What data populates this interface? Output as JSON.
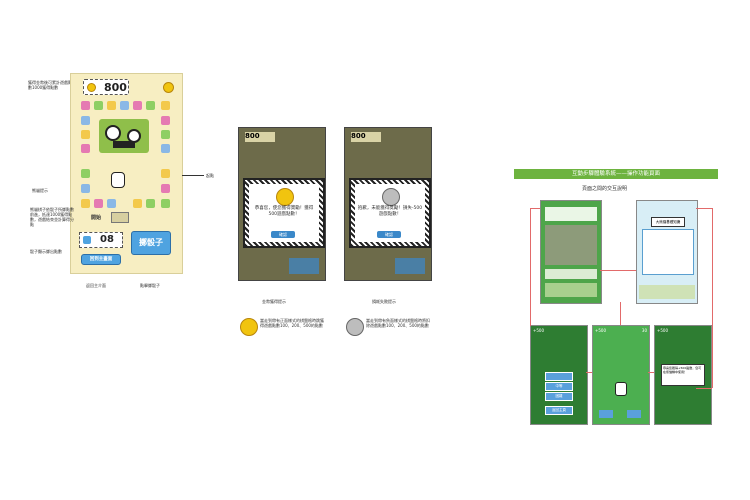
{
  "board": {
    "score": "800",
    "score_note": "獲得金幣後可累計遊戲點數1000獲得點數",
    "label_start": "開始",
    "label_right": "起點",
    "dice_value": "08",
    "throw_label": "擲骰子",
    "back_label": "回到主畫面",
    "note_monkey": "熊貓提示",
    "note_route": "熊貓棋子依骰子所擲點數前進，抵達1000獲得點數，遊戲結束並計算得分點",
    "note_dice": "骰子顯示擲出點數",
    "caption_back": "返回主介面",
    "caption_throw": "點擊擲骰子"
  },
  "dialogs": [
    {
      "score": "800",
      "message": "恭喜您，使您獲得獎勵！獲得500遊戲點數！",
      "button": "確認",
      "caption": "金幣獲得提示",
      "legend": "當走到帶有正面樣式的棋盤格時跳獲得遊戲點數100、200、500的點數"
    },
    {
      "score": "800",
      "message": "抱歉，未能獲得獎勵！損失-500遊戲點數！",
      "button": "確認",
      "caption": "損耗失敗提示",
      "legend": "當走到帶有負面樣式的棋盤格時將扣除遊戲點數100、200、500的點數"
    }
  ],
  "right": {
    "header": "互動步驟體驗系統——操作功能頁面",
    "subtitle": "頁面之間的交互說明",
    "screen_titles": [
      "",
      "大熊貓基礎知識"
    ],
    "bottom_screens": [
      {
        "score": "+500",
        "buttons": [
          "",
          "中等",
          "困難",
          "返回主頁"
        ]
      },
      {
        "score": "+500",
        "count": "30"
      },
      {
        "score": "+500",
        "message": "恭喜您獲得+500點數，您可在熊貓棋中使用！"
      }
    ]
  },
  "colors": {
    "accent": "#6db33f",
    "board_bg": "#f7eec2",
    "button": "#4fa3e0",
    "link_line": "#e26a6a"
  }
}
